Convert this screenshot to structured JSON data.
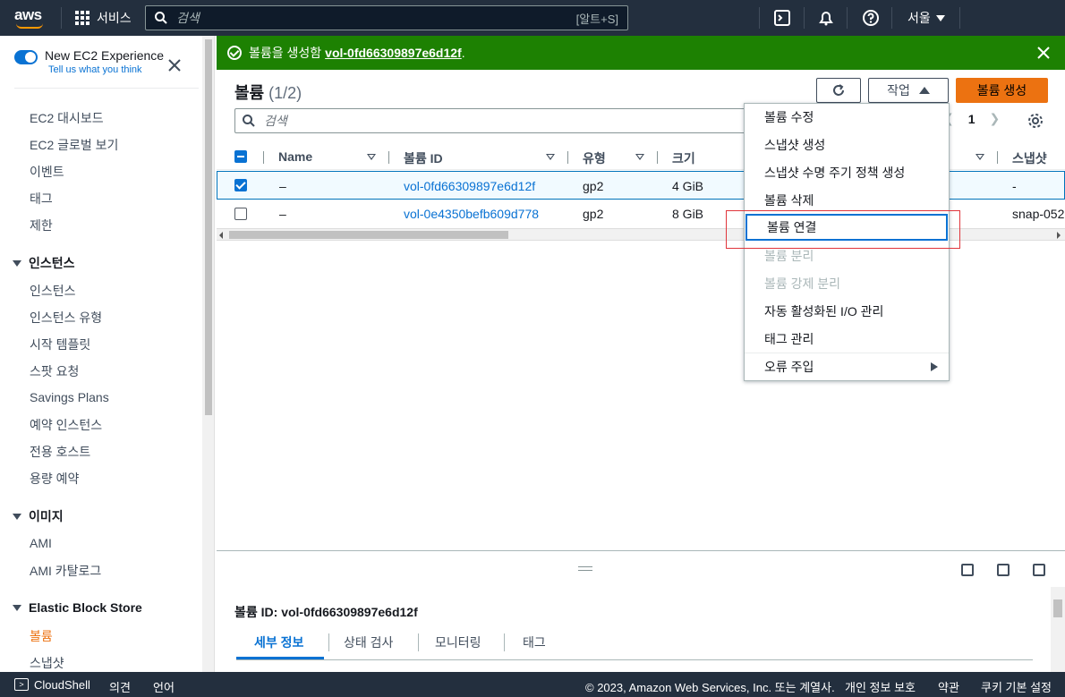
{
  "topnav": {
    "logo": "aws",
    "services_label": "서비스",
    "search_placeholder": "검색",
    "search_shortcut": "[알트+S]",
    "region_label": "서울"
  },
  "sidebar": {
    "experience_title": "New EC2 Experience",
    "experience_sub": "Tell us what you think",
    "top_items": [
      "EC2 대시보드",
      "EC2 글로벌 보기",
      "이벤트",
      "태그",
      "제한"
    ],
    "group_instances": "인스턴스",
    "instances_items": [
      "인스턴스",
      "인스턴스 유형",
      "시작 템플릿",
      "스팟 요청",
      "Savings Plans",
      "예약 인스턴스",
      "전용 호스트",
      "용량 예약"
    ],
    "group_images": "이미지",
    "images_items": [
      "AMI",
      "AMI 카탈로그"
    ],
    "group_ebs": "Elastic Block Store",
    "ebs_items": [
      "볼륨",
      "스냅샷"
    ]
  },
  "flash": {
    "message": "볼륨을 생성함",
    "volume_link": "vol-0fd66309897e6d12f",
    "suffix": "."
  },
  "header": {
    "title": "볼륨",
    "count": "(1/2)",
    "actions_label": "작업",
    "create_label": "볼륨 생성",
    "search_placeholder": "검색",
    "page_number": "1"
  },
  "table": {
    "columns": [
      "Name",
      "볼륨 ID",
      "유형",
      "크기",
      "스냅샷"
    ],
    "rows": [
      {
        "name": "–",
        "volume_id": "vol-0fd66309897e6d12f",
        "type": "gp2",
        "size": "4 GiB",
        "snapshot": "-",
        "selected": true
      },
      {
        "name": "–",
        "volume_id": "vol-0e4350befb609d778",
        "type": "gp2",
        "size": "8 GiB",
        "snapshot": "snap-052",
        "selected": false
      }
    ]
  },
  "actions_menu": {
    "items": [
      {
        "label": "볼륨 수정",
        "disabled": false
      },
      {
        "label": "스냅샷 생성",
        "disabled": false
      },
      {
        "label": "스냅샷 수명 주기 정책 생성",
        "disabled": false
      },
      {
        "label": "볼륨 삭제",
        "disabled": false
      },
      {
        "label": "볼륨 연결",
        "disabled": false,
        "focused": true
      },
      {
        "label": "볼륨 분리",
        "disabled": true
      },
      {
        "label": "볼륨 강제 분리",
        "disabled": true
      },
      {
        "label": "자동 활성화된 I/O 관리",
        "disabled": false
      },
      {
        "label": "태그 관리",
        "disabled": false
      },
      {
        "label": "오류 주입",
        "disabled": false,
        "submenu": true
      }
    ]
  },
  "split_panel": {
    "title": "볼륨 ID: vol-0fd66309897e6d12f",
    "tabs": [
      "세부 정보",
      "상태 검사",
      "모니터링",
      "태그"
    ]
  },
  "footer": {
    "cloudshell": "CloudShell",
    "feedback": "의견",
    "language": "언어",
    "copyright": "© 2023, Amazon Web Services, Inc. 또는 계열사.",
    "privacy": "개인 정보 보호",
    "terms": "약관",
    "cookies": "쿠키 기본 설정"
  },
  "colors": {
    "nav_bg": "#232f3e",
    "success": "#1d8102",
    "primary_button": "#ec7211",
    "link": "#0972d3",
    "highlight": "#e0353b"
  },
  "icons": [
    "grid-icon",
    "search-icon",
    "cloudshell-icon",
    "bell-icon",
    "help-icon",
    "close-icon",
    "refresh-icon",
    "settings-icon",
    "check-circle-icon"
  ]
}
